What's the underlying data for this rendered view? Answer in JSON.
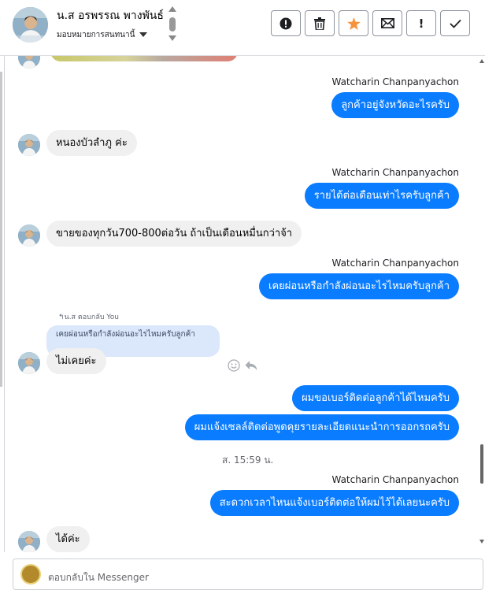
{
  "header": {
    "contact_name": "น.ส อรพรรณ พางพันธ์",
    "contact_sub": "มอบหมายการสนทนานี้",
    "buttons": [
      {
        "icon": "exclamation-circle-icon",
        "label": "!"
      },
      {
        "icon": "trash-icon",
        "label": ""
      },
      {
        "icon": "star-icon",
        "label": ""
      },
      {
        "icon": "envelope-icon",
        "label": ""
      },
      {
        "icon": "exclamation-icon",
        "label": "!"
      },
      {
        "icon": "check-icon",
        "label": ""
      }
    ],
    "star_color": "#f7923a"
  },
  "thread": {
    "outgoing_color": "#0a7cff",
    "incoming_color": "#f0f0f0",
    "sender_name": "Watcharin Chanpanyachon",
    "messages": [
      {
        "dir": "out",
        "sender": "Watcharin Chanpanyachon",
        "text": "ลูกค้าอยู่จังหวัดอะไรครับ"
      },
      {
        "dir": "in",
        "text": "หนองบัวลำภู ค่ะ"
      },
      {
        "dir": "out",
        "sender": "Watcharin Chanpanyachon",
        "text": "รายได้ต่อเดือนเท่าไรครับลูกค้า"
      },
      {
        "dir": "in",
        "text": "ขายของทุกวัน700-800ต่อวัน ถ้าเป็นเดือนหมื่นกว่าจ้า"
      },
      {
        "dir": "out",
        "sender": "Watcharin Chanpanyachon",
        "text": "เคยผ่อนหรือกำลังผ่อนอะไรไหมครับลูกค้า"
      },
      {
        "dir": "in",
        "reply_meta": "น.ส ตอบกลับ You",
        "quoted": "เคยผ่อนหรือกำลังผ่อนอะไรไหมครับลูกค้า",
        "text": "ไม่เคยค่ะ"
      },
      {
        "dir": "out",
        "text": "ผมขอเบอร์ติดต่อลูกค้าได้ไหมครับ"
      },
      {
        "dir": "out",
        "text": "ผมแจ้งเซลล์ติดต่อพูดคุยรายละเอียดแนะนำการออกรถครับ"
      },
      {
        "dir": "out",
        "sender": "Watcharin Chanpanyachon",
        "text": "สะดวกเวลาไหนแจ้งเบอร์ติดต่อให้ผมไว้ได้เลยนะครับ"
      },
      {
        "dir": "in",
        "text": "ได้ค่ะ"
      }
    ],
    "timestamp": "ส. 15:59 น."
  },
  "composer": {
    "placeholder": "ตอบกลับใน Messenger"
  }
}
